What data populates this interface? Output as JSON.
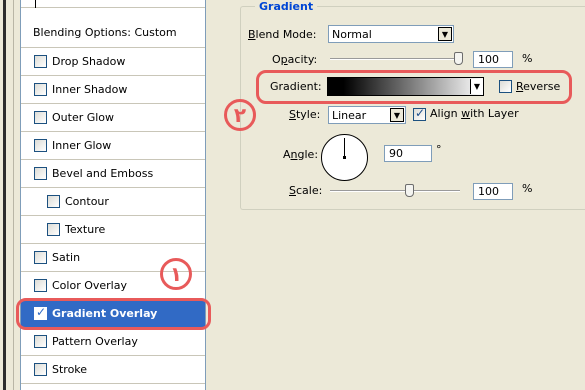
{
  "sidebar": {
    "header": "Blending Options: Custom",
    "items": [
      {
        "label": "Drop Shadow",
        "checked": false
      },
      {
        "label": "Inner Shadow",
        "checked": false
      },
      {
        "label": "Outer Glow",
        "checked": false
      },
      {
        "label": "Inner Glow",
        "checked": false
      },
      {
        "label": "Bevel and Emboss",
        "checked": false
      },
      {
        "label": "Contour",
        "checked": false
      },
      {
        "label": "Texture",
        "checked": false
      },
      {
        "label": "Satin",
        "checked": false
      },
      {
        "label": "Color Overlay",
        "checked": false
      },
      {
        "label": "Gradient Overlay",
        "checked": true,
        "selected": true
      },
      {
        "label": "Pattern Overlay",
        "checked": false
      },
      {
        "label": "Stroke",
        "checked": false
      }
    ]
  },
  "gradient_panel": {
    "group_title": "Gradient",
    "blend_mode": {
      "label_prefix": "B",
      "label_rest": "lend Mode:",
      "value": "Normal"
    },
    "opacity": {
      "label_pre": "O",
      "label_u": "p",
      "label_post": "acity:",
      "value": "100",
      "unit": "%",
      "level": 1.0
    },
    "gradient": {
      "label": "Gradient:",
      "reverse_u": "R",
      "reverse_rest": "everse",
      "reverse_checked": false
    },
    "style": {
      "label_u": "S",
      "label_rest": "tyle:",
      "value": "Linear",
      "align_pre": "Align ",
      "align_u": "w",
      "align_post": "ith Layer",
      "align_checked": true
    },
    "angle": {
      "label_pre": "A",
      "label_u": "n",
      "label_post": "gle:",
      "value": "90",
      "unit": "°"
    },
    "scale": {
      "label_u": "S",
      "label_post": "cale:",
      "value": "100",
      "unit": "%",
      "level": 0.5
    }
  },
  "annotations": {
    "one": "١",
    "two": "٢"
  },
  "colors": {
    "highlight": "#e85a5a",
    "selection": "#316ac5",
    "group_title": "#0046d5"
  }
}
